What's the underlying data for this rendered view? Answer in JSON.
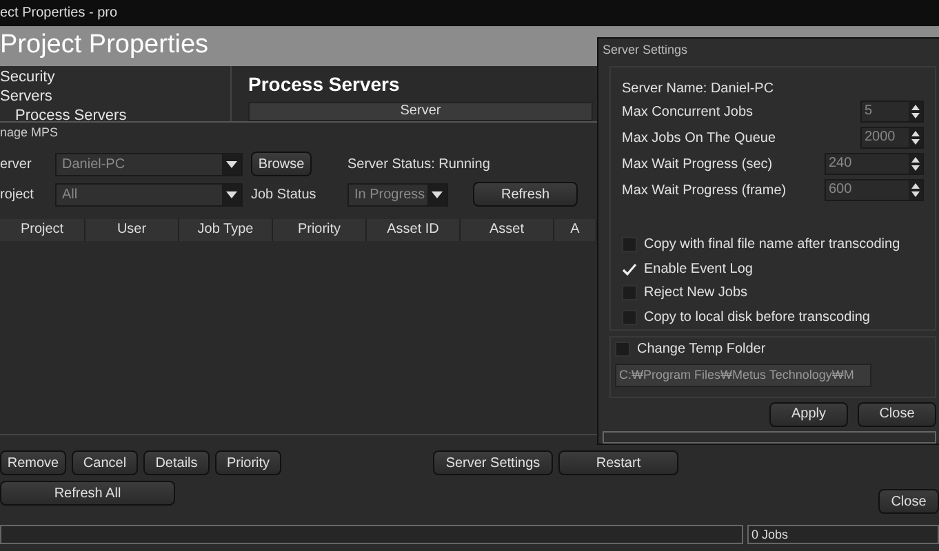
{
  "back_window": {
    "title": "ect Properties - pro",
    "header": "Project Properties",
    "tree": [
      {
        "label": "Security"
      },
      {
        "label": "Servers",
        "children": [
          {
            "label": "Process Servers"
          }
        ]
      }
    ],
    "panel_title": "Process Servers",
    "table": {
      "columns": [
        "Server"
      ]
    }
  },
  "manage_window": {
    "title": "nage MPS",
    "server_label": "erver",
    "server_value": "Daniel-PC",
    "browse": "Browse",
    "server_status": "Server Status: Running",
    "project_label": "roject",
    "project_value": "All",
    "job_status_label": "Job Status",
    "job_status_value": "In Progress",
    "refresh": "Refresh",
    "columns": [
      "Project",
      "User",
      "Job Type",
      "Priority",
      "Asset ID",
      "Asset",
      "A"
    ],
    "job_buttons": [
      "Remove",
      "Cancel",
      "Details",
      "Priority"
    ],
    "server_buttons": [
      "Server Settings",
      "Restart"
    ],
    "refresh_all": "Refresh All",
    "close": "Close",
    "status_bar": {
      "jobs": "0 Jobs"
    }
  },
  "settings_window": {
    "title": "Server Settings",
    "server_name": "Server Name: Daniel-PC",
    "spinners": [
      {
        "label": "Max Concurrent Jobs",
        "value": "5",
        "kind": "narrow"
      },
      {
        "label": "Max Jobs On The Queue",
        "value": "2000",
        "kind": "narrow"
      },
      {
        "label": "Max Wait Progress (sec)",
        "value": "240",
        "kind": "wide"
      },
      {
        "label": "Max Wait Progress (frame)",
        "value": "600",
        "kind": "wide"
      }
    ],
    "checkboxes": [
      {
        "label": "Copy with final file name after transcoding",
        "checked": false
      },
      {
        "label": "Enable Event Log",
        "checked": true
      },
      {
        "label": "Reject New Jobs",
        "checked": false
      },
      {
        "label": "Copy to local disk before transcoding",
        "checked": false
      }
    ],
    "temp_folder": {
      "label": "Change Temp Folder",
      "checked": false,
      "path": "C:₩Program Files₩Metus Technology₩M"
    },
    "buttons": [
      "Apply",
      "Close"
    ]
  }
}
